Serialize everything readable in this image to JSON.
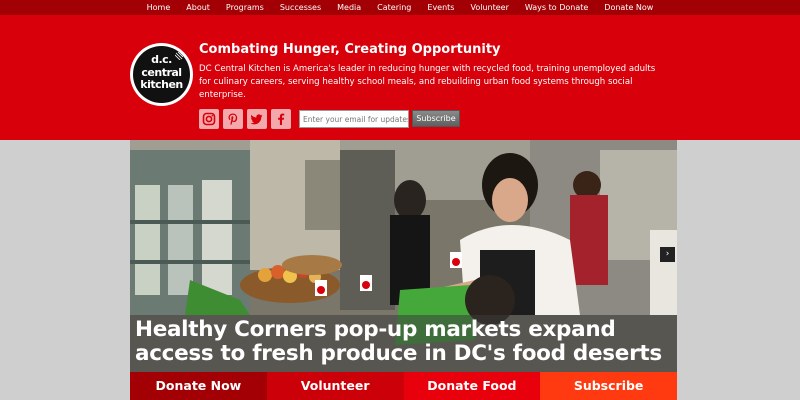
{
  "nav": {
    "items": [
      "Home",
      "About",
      "Programs",
      "Successes",
      "Media",
      "Catering",
      "Events",
      "Volunteer",
      "Ways to Donate",
      "Donate Now"
    ]
  },
  "logo": {
    "line1": "d.c.",
    "line2": "central",
    "line3": "kitchen"
  },
  "header": {
    "tagline": "Combating Hunger, Creating Opportunity",
    "description": "DC Central Kitchen is America's leader in reducing hunger with recycled food, training unemployed adults for culinary careers, serving healthy school meals, and rebuilding urban food systems through social enterprise."
  },
  "social": {
    "icons": [
      "instagram-icon",
      "pinterest-icon",
      "twitter-icon",
      "facebook-icon"
    ]
  },
  "signup": {
    "email_placeholder": "Enter your email for updates",
    "subscribe_label": "Subscribe"
  },
  "hero": {
    "caption": "Healthy Corners pop-up markets expand access to fresh produce in DC's food deserts",
    "next_label": "›"
  },
  "ctas": [
    {
      "label": "Donate Now",
      "color": "#a30006"
    },
    {
      "label": "Volunteer",
      "color": "#cc0009"
    },
    {
      "label": "Donate Food",
      "color": "#e8000c"
    },
    {
      "label": "Subscribe",
      "color": "#ff3a10"
    }
  ],
  "colors": {
    "nav_bg": "#a30006",
    "header_bg": "#d8000b",
    "page_bg": "#cfcfcf"
  }
}
